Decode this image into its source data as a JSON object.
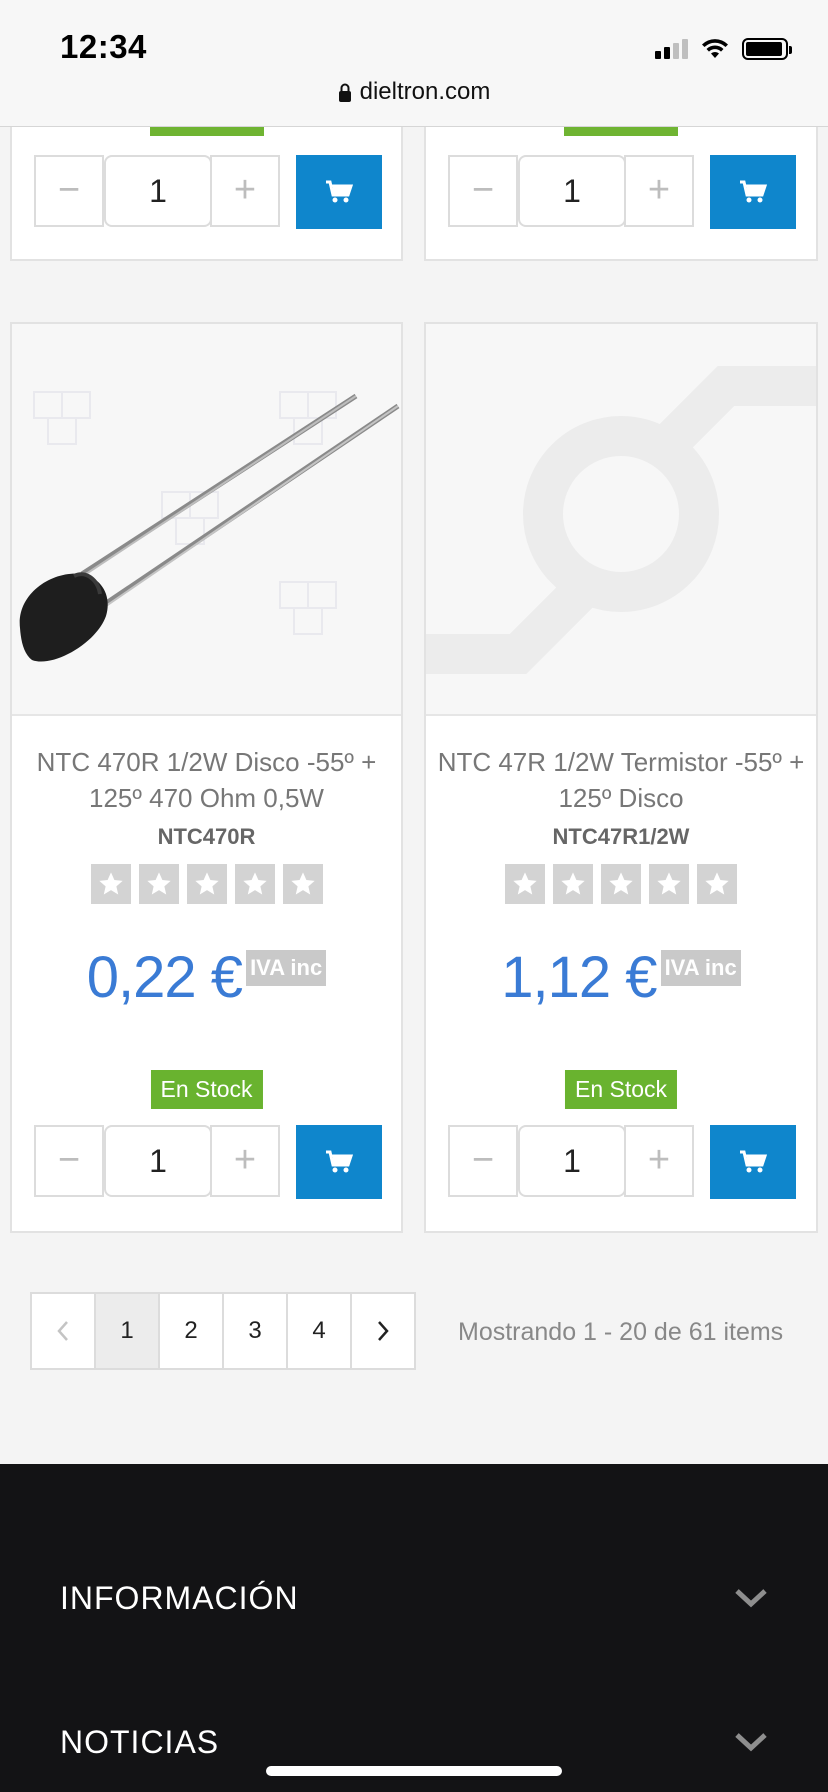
{
  "status_bar": {
    "time": "12:34",
    "url": "dieltron.com"
  },
  "top_cards": [
    {
      "quantity": "1",
      "minus": "−",
      "plus": "+"
    },
    {
      "quantity": "1",
      "minus": "−",
      "plus": "+"
    }
  ],
  "products": [
    {
      "title": "NTC 470R 1/2W Disco -55º + 125º 470 Ohm 0,5W",
      "sku": "NTC470R",
      "rating": 0,
      "price": "0,22 €",
      "tax_label": "IVA inc",
      "stock": "En Stock",
      "quantity": "1",
      "minus": "−",
      "plus": "+"
    },
    {
      "title": "NTC 47R 1/2W Termistor -55º + 125º Disco",
      "sku": "NTC47R1/2W",
      "rating": 0,
      "price": "1,12 €",
      "tax_label": "IVA inc",
      "stock": "En Stock",
      "quantity": "1",
      "minus": "−",
      "plus": "+"
    }
  ],
  "pagination": {
    "pages": [
      "1",
      "2",
      "3",
      "4"
    ],
    "current": "1",
    "summary": "Mostrando 1 - 20 de 61 items"
  },
  "footer": {
    "sections": [
      "INFORMACIÓN",
      "NOTICIAS"
    ]
  },
  "colors": {
    "accent_blue": "#0f86cc",
    "price_blue": "#3a7bd5",
    "stock_green": "#69b32f",
    "footer_bg": "#131315"
  }
}
